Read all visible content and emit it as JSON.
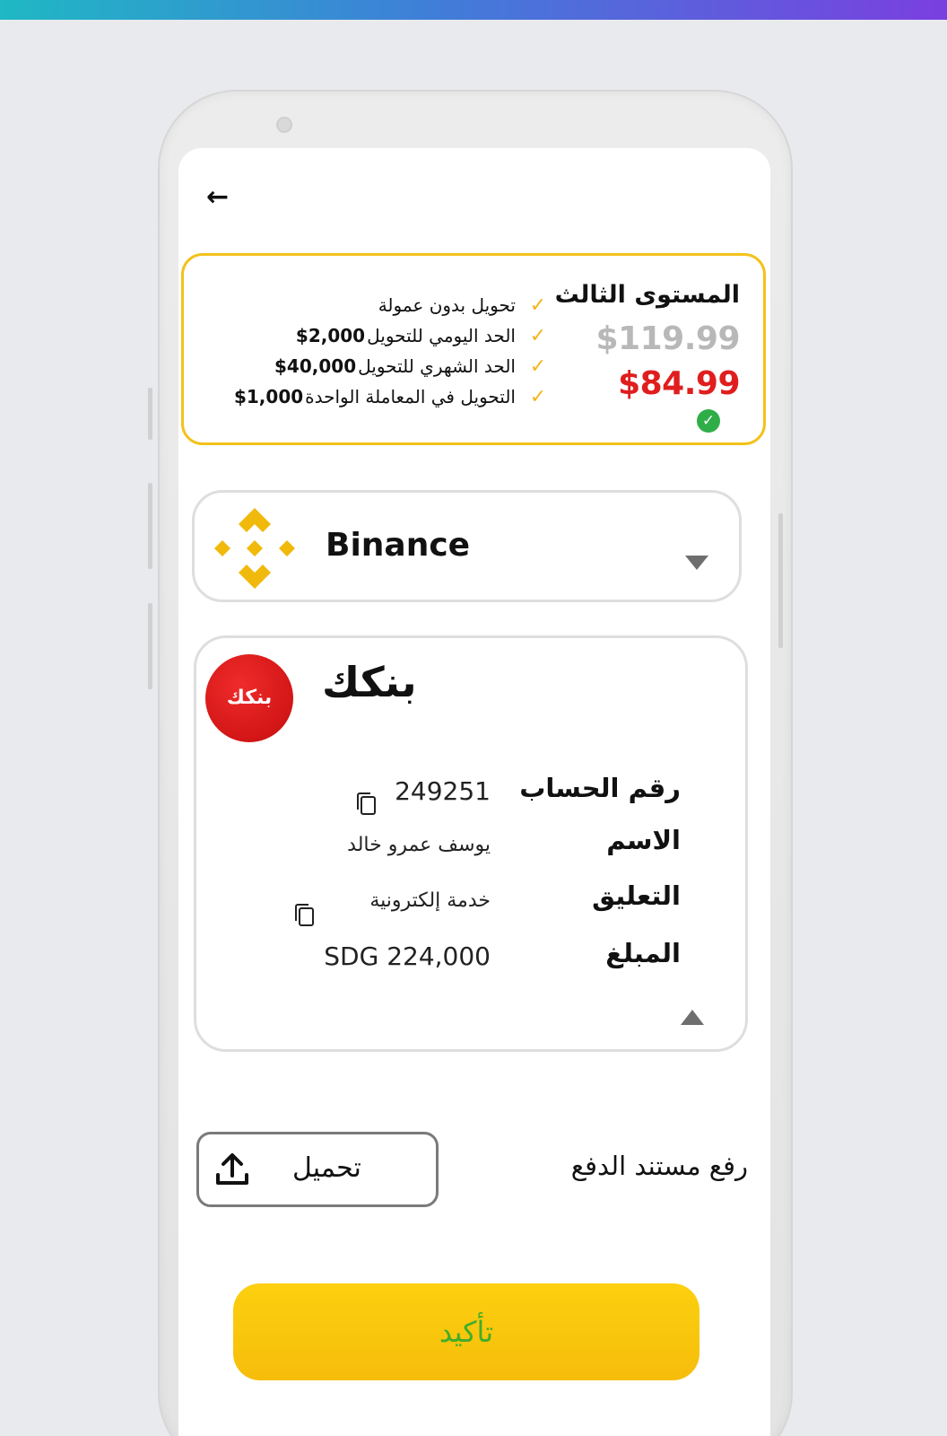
{
  "plan": {
    "title": "المستوى الثالث",
    "old_price": "$119.99",
    "new_price": "$84.99",
    "features": [
      {
        "text": "تحويل بدون عمولة",
        "value": ""
      },
      {
        "text": "الحد اليومي للتحويل",
        "value": "$2,000"
      },
      {
        "text": "الحد الشهري للتحويل",
        "value": "$40,000"
      },
      {
        "text": "التحويل في المعاملة الواحدة",
        "value": "$1,000"
      }
    ]
  },
  "payment_method": {
    "selected": "Binance"
  },
  "bank": {
    "logo_text": "بنكك",
    "name": "بنكك",
    "account_number_label": "رقم الحساب",
    "account_number": "249251",
    "name_label": "الاسم",
    "holder_name": "يوسف عمرو خالد",
    "comment_label": "التعليق",
    "comment": "خدمة إلكترونية",
    "amount_label": "المبلغ",
    "amount": "SDG 224,000"
  },
  "upload": {
    "label": "رفع مستند الدفع",
    "button_label": "تحميل"
  },
  "confirm": {
    "label": "تأكيد"
  },
  "colors": {
    "accent_yellow": "#f3c21b",
    "price_red": "#e01e1e",
    "check_green": "#2fae48",
    "confirm_text_green": "#3fae2a",
    "binance_gold": "#f0b90b"
  }
}
